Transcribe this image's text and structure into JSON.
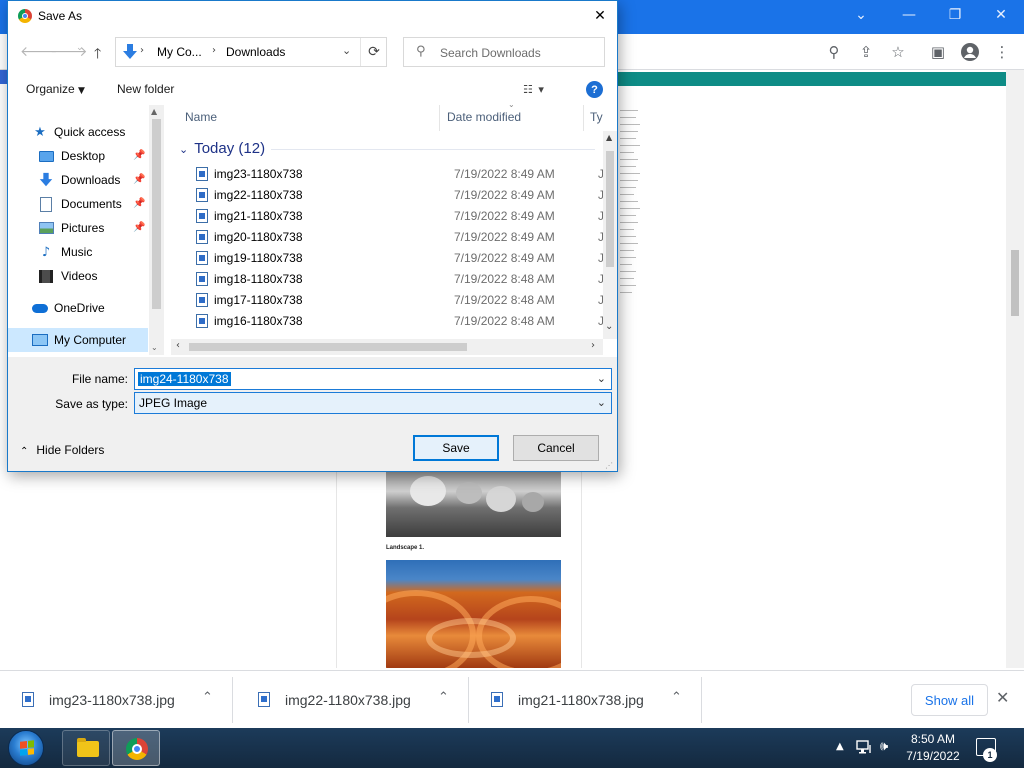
{
  "dialog": {
    "title": "Save As",
    "close_glyph": "✕",
    "address": {
      "crumbs": [
        "My Co...",
        "Downloads"
      ]
    },
    "search": {
      "placeholder": "Search Downloads"
    },
    "commands": {
      "organize": "Organize",
      "new_folder": "New folder"
    },
    "nav": [
      {
        "label": "Quick access",
        "icon": "star-icon",
        "kind": "root"
      },
      {
        "label": "Desktop",
        "icon": "desktop-icon",
        "pinned": true
      },
      {
        "label": "Downloads",
        "icon": "download-arrow-icon",
        "pinned": true
      },
      {
        "label": "Documents",
        "icon": "document-icon",
        "pinned": true
      },
      {
        "label": "Pictures",
        "icon": "pictures-icon",
        "pinned": true
      },
      {
        "label": "Music",
        "icon": "music-note-icon"
      },
      {
        "label": "Videos",
        "icon": "film-icon"
      },
      {
        "label": "OneDrive",
        "icon": "cloud-icon",
        "kind": "root"
      },
      {
        "label": "My Computer",
        "icon": "computer-icon",
        "kind": "root",
        "selected": true
      }
    ],
    "columns": {
      "name": "Name",
      "date": "Date modified",
      "type": "Ty"
    },
    "group": "Today (12)",
    "files": [
      {
        "name": "img23-1180x738",
        "date": "7/19/2022 8:49 AM",
        "type": "JP"
      },
      {
        "name": "img22-1180x738",
        "date": "7/19/2022 8:49 AM",
        "type": "JP"
      },
      {
        "name": "img21-1180x738",
        "date": "7/19/2022 8:49 AM",
        "type": "JP"
      },
      {
        "name": "img20-1180x738",
        "date": "7/19/2022 8:49 AM",
        "type": "JP"
      },
      {
        "name": "img19-1180x738",
        "date": "7/19/2022 8:49 AM",
        "type": "JP"
      },
      {
        "name": "img18-1180x738",
        "date": "7/19/2022 8:48 AM",
        "type": "JP"
      },
      {
        "name": "img17-1180x738",
        "date": "7/19/2022 8:48 AM",
        "type": "JP"
      },
      {
        "name": "img16-1180x738",
        "date": "7/19/2022 8:48 AM",
        "type": "JP"
      }
    ],
    "form": {
      "file_name_label": "File name:",
      "file_name_value": "img24-1180x738",
      "type_label": "Save as type:",
      "type_value": "JPEG Image",
      "hide_folders": "Hide Folders",
      "save": "Save",
      "cancel": "Cancel"
    }
  },
  "webpage": {
    "caption": "Landscape 1."
  },
  "downloads": {
    "items": [
      "img23-1180x738.jpg",
      "img22-1180x738.jpg",
      "img21-1180x738.jpg"
    ],
    "show_all": "Show all"
  },
  "taskbar": {
    "time": "8:50 AM",
    "date": "7/19/2022",
    "notification_count": "1"
  },
  "colors": {
    "accent": "#1a73e8",
    "selection": "#0078d7",
    "group_header": "#1e3287"
  }
}
